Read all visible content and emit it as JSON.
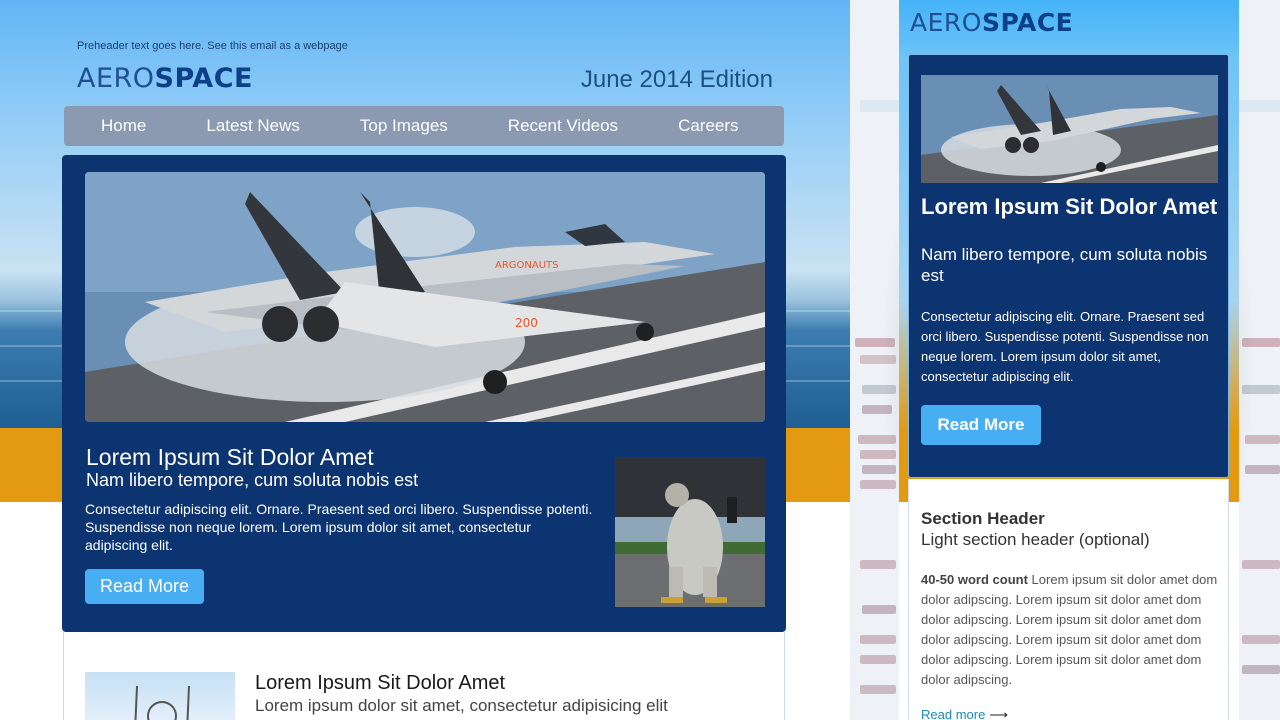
{
  "desktop": {
    "preheader": "Preheader text goes here. See this email as a webpage",
    "logo": {
      "light": "AERO",
      "bold": "SPACE"
    },
    "edition": "June 2014 Edition",
    "nav": [
      "Home",
      "Latest News",
      "Top Images",
      "Recent Videos",
      "Careers"
    ],
    "hero": {
      "title": "Lorem Ipsum Sit Dolor Amet",
      "subtitle": "Nam libero tempore, cum soluta nobis est",
      "body": "Consectetur adipiscing elit. Ornare. Praesent sed orci libero. Suspendisse potenti. Suspendisse non neque lorem. Lorem ipsum dolor sit amet, consectetur adipiscing elit.",
      "button": "Read More"
    },
    "second": {
      "title": "Lorem Ipsum Sit Dolor Amet",
      "subtitle": "Lorem ipsum dolor sit amet, consectetur adipisicing elit"
    }
  },
  "mobile": {
    "logo": {
      "light": "AERO",
      "bold": "SPACE"
    },
    "hero": {
      "title": "Lorem Ipsum Sit Dolor Amet",
      "subtitle": "Nam libero tempore, cum soluta nobis est",
      "body": "Consectetur adipiscing elit. Ornare. Praesent sed orci libero. Suspendisse potenti. Suspendisse non neque lorem. Lorem ipsum dolor sit amet, consectetur adipiscing elit.",
      "button": "Read More"
    },
    "section": {
      "header": "Section Header",
      "subheader": "Light section header (optional)",
      "lead": "40-50 word count",
      "body": "Lorem ipsum sit dolor amet dom dolor adipscing. Lorem ipsum sit dolor amet dom dolor adipscing. Lorem ipsum sit dolor amet dom dolor adipscing. Lorem ipsum sit dolor amet dom dolor adipscing. Lorem ipsum sit dolor amet dom dolor adipscing.",
      "link": "Read more"
    }
  },
  "colors": {
    "navy": "#0c3470",
    "sky": "#61b5f6",
    "button": "#47aef3",
    "orange": "#e39a12",
    "nav": "#8b9ab0"
  },
  "icons": {
    "link_arrow": "right-arrow-icon"
  }
}
